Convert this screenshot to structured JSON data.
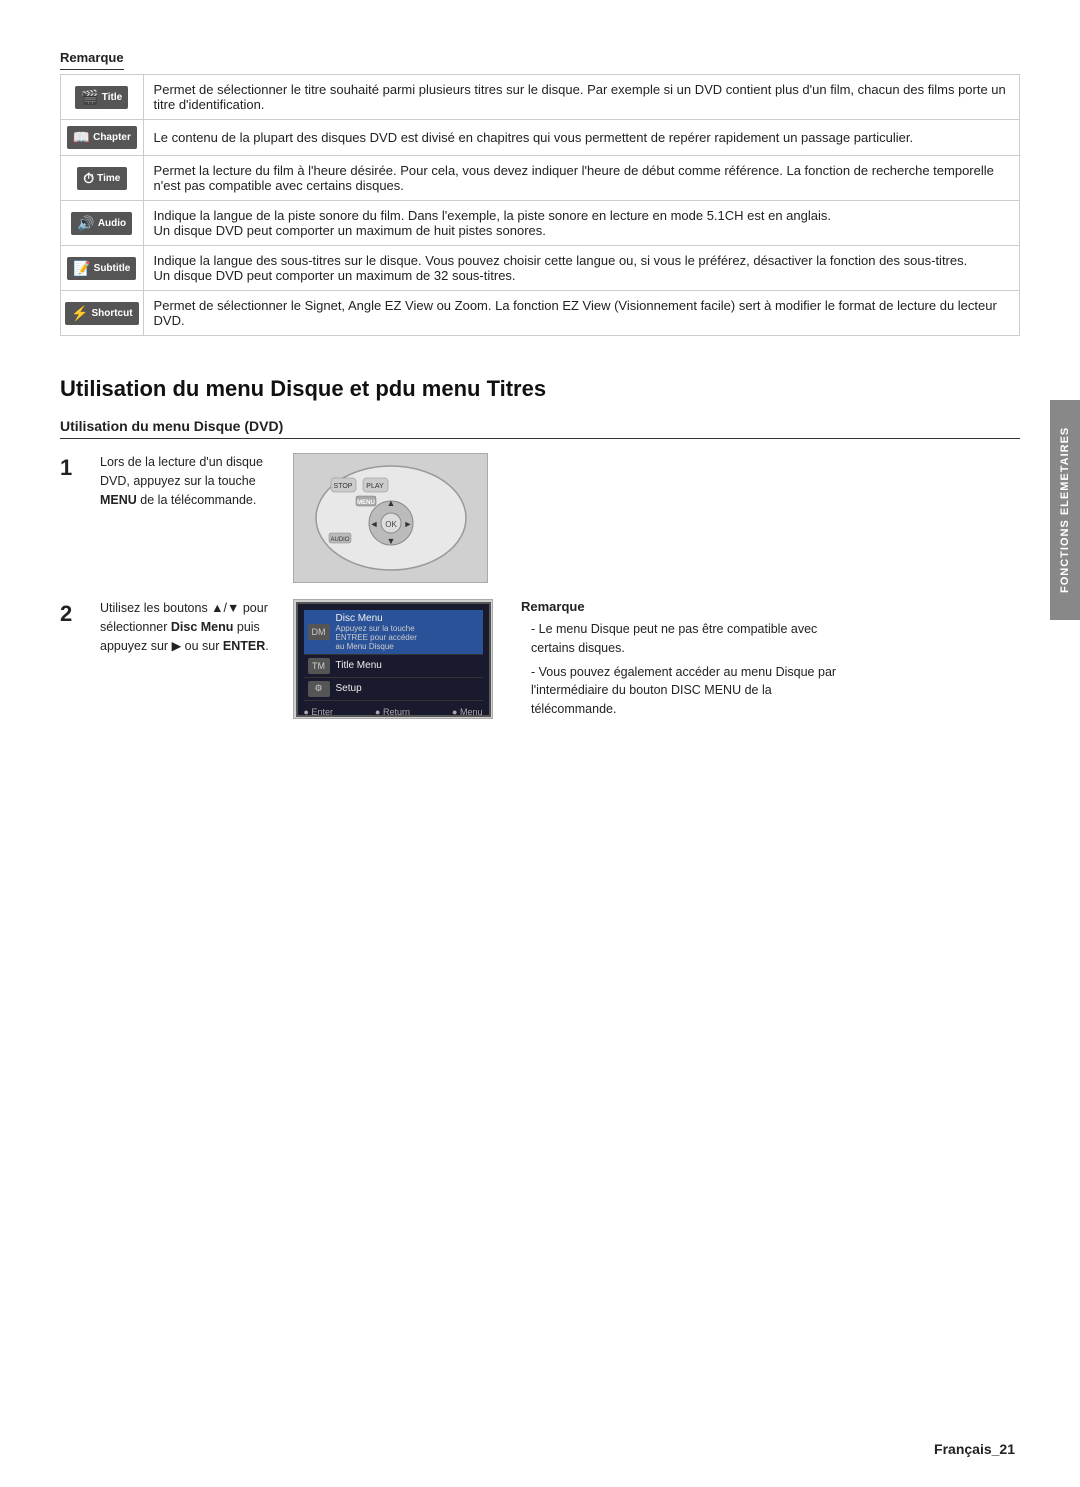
{
  "page": {
    "number": "Français_21",
    "side_tab": "FONCTIONS ELEMETAIRES"
  },
  "remarque_heading": "Remarque",
  "features": [
    {
      "icon_label": "Title",
      "icon_symbol": "🎬",
      "text": "Permet de sélectionner le titre souhaité parmi plusieurs titres sur le disque. Par exemple si un DVD contient plus d'un film, chacun des films porte un titre d'identification."
    },
    {
      "icon_label": "Chapter",
      "icon_symbol": "📖",
      "text": "Le contenu de la plupart des disques DVD est divisé en chapitres qui vous permettent de repérer rapidement un passage particulier."
    },
    {
      "icon_label": "Time",
      "icon_symbol": "🕐",
      "text": "Permet la lecture du film à l'heure désirée. Pour cela, vous devez indiquer l'heure de début comme référence. La fonction de recherche temporelle n'est pas compatible avec certains disques."
    },
    {
      "icon_label": "Audio",
      "icon_symbol": "🔊",
      "text": "Indique la langue de la piste sonore du film. Dans l'exemple, la piste sonore en lecture en mode 5.1CH est en anglais.\nUn disque DVD peut comporter un maximum de huit pistes sonores."
    },
    {
      "icon_label": "Subtitle",
      "icon_symbol": "📝",
      "text": "Indique la langue des sous-titres sur le disque. Vous pouvez choisir cette langue ou, si vous le préférez, désactiver la fonction des sous-titres.\nUn disque DVD peut comporter un maximum de 32 sous-titres."
    },
    {
      "icon_label": "Shortcut",
      "icon_symbol": "⚡",
      "text": "Permet de sélectionner le Signet, Angle EZ View ou Zoom. La fonction EZ View (Visionnement facile) sert à modifier le format de lecture du lecteur DVD."
    }
  ],
  "section": {
    "title": "Utilisation du menu Disque et pdu menu Titres",
    "subsection": "Utilisation du menu Disque (DVD)"
  },
  "steps": [
    {
      "number": "1",
      "text": "Lors de la lecture d'un disque DVD, appuyez sur la touche MENU de la télécommande.",
      "bold_parts": [
        "MENU"
      ]
    },
    {
      "number": "2",
      "text_pre": "Utilisez les boutons ▲/▼ pour sélectionner ",
      "bold1": "Disc Menu",
      "text_mid": " puis appuyez sur ▶ ou sur ",
      "bold2": "ENTER",
      "text_post": ".",
      "screen": {
        "rows": [
          {
            "label": "Disc Menu",
            "desc": "Appuyez sur la touche ENTREE pour accéder au Menu Disque",
            "selected": true
          },
          {
            "label": "Title Menu",
            "desc": "",
            "selected": false
          },
          {
            "label": "Setup",
            "desc": "",
            "selected": false
          }
        ],
        "nav": [
          "● Enter",
          "● Return",
          "● Menu"
        ]
      }
    }
  ],
  "note": {
    "title": "Remarque",
    "items": [
      "Le menu Disque peut ne pas être compatible avec certains disques.",
      "Vous pouvez également accéder au menu Disque par l'intermédiaire du bouton DISC MENU de la télécommande."
    ]
  }
}
